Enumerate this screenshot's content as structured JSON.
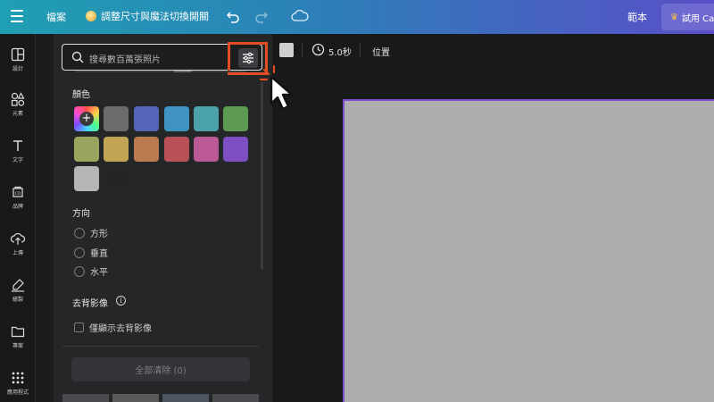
{
  "topbar": {
    "file_label": "檔案",
    "resize_label": "調整尺寸與魔法切換開關",
    "template_label": "範本",
    "trial_label": "試用 Ca"
  },
  "rail": {
    "items": [
      {
        "label": "設計",
        "icon": "layout-icon"
      },
      {
        "label": "元素",
        "icon": "elements-icon"
      },
      {
        "label": "文字",
        "icon": "text-icon"
      },
      {
        "label": "品牌",
        "icon": "brand-icon"
      },
      {
        "label": "上傳",
        "icon": "upload-icon"
      },
      {
        "label": "繪製",
        "icon": "draw-icon"
      },
      {
        "label": "專案",
        "icon": "folder-icon"
      },
      {
        "label": "應用程式",
        "icon": "apps-icon"
      }
    ]
  },
  "search": {
    "placeholder": "搜尋數百萬張照片"
  },
  "filters": {
    "color_title": "顏色",
    "colors": [
      "#6b6b6d",
      "#5566b8",
      "#3f93c2",
      "#4ba2ac",
      "#5f9a55",
      "#9aa45e",
      "#c2a656",
      "#bb7a50",
      "#b85155",
      "#bb5a96",
      "#7d4fc2",
      "#b5b5b7",
      "#252527"
    ],
    "orientation_title": "方向",
    "orientations": [
      "方形",
      "垂直",
      "水平"
    ],
    "bg_remove_title": "去背影像",
    "bg_remove_checkbox": "僅顯示去背影像",
    "clear_all": "全部清除 (0)"
  },
  "context_toolbar": {
    "duration": "5.0秒",
    "position": "位置"
  },
  "accent": {
    "highlight": "#e04e22",
    "page_border": "#7a4fd1",
    "page_fill": "#aeadaf"
  }
}
